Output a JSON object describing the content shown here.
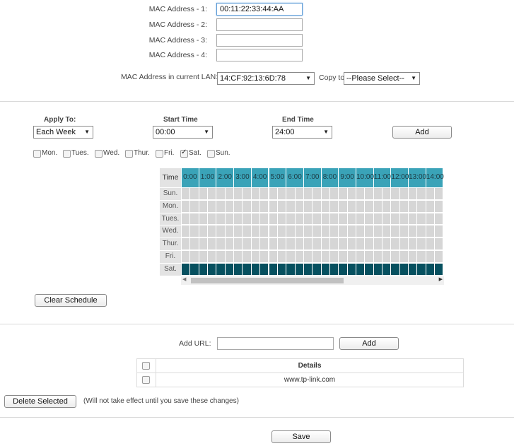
{
  "mac": {
    "labels": [
      "MAC Address - 1:",
      "MAC Address - 2:",
      "MAC Address - 3:",
      "MAC Address - 4:"
    ],
    "values": [
      "00:11:22:33:44:AA",
      "",
      "",
      ""
    ],
    "current_lan_label": "MAC Address in current LAN:",
    "current_lan_value": "14:CF:92:13:6D:78",
    "copy_to_label": "Copy to",
    "copy_to_value": "--Please Select--"
  },
  "schedule": {
    "apply_to_label": "Apply To:",
    "apply_to_value": "Each Week",
    "start_time_label": "Start Time",
    "start_time_value": "00:00",
    "end_time_label": "End Time",
    "end_time_value": "24:00",
    "add_label": "Add",
    "days": [
      {
        "label": "Mon.",
        "checked": false
      },
      {
        "label": "Tues.",
        "checked": false
      },
      {
        "label": "Wed.",
        "checked": false
      },
      {
        "label": "Thur.",
        "checked": false
      },
      {
        "label": "Fri.",
        "checked": false
      },
      {
        "label": "Sat.",
        "checked": true
      },
      {
        "label": "Sun.",
        "checked": false
      }
    ],
    "grid": {
      "corner_label": "Time",
      "hours": [
        "0:00",
        "1:00",
        "2:00",
        "3:00",
        "4:00",
        "5:00",
        "6:00",
        "7:00",
        "8:00",
        "9:00",
        "10:00",
        "11:00",
        "12:00",
        "13:00",
        "14:00"
      ],
      "rows": [
        "Sun.",
        "Mon.",
        "Tues.",
        "Wed.",
        "Thur.",
        "Fri.",
        "Sat."
      ],
      "active_rows": [
        "Sat."
      ],
      "header_color": "#3aa3b8",
      "active_color": "#06505f",
      "inactive_color": "#d6d6d6"
    },
    "clear_label": "Clear Schedule"
  },
  "url": {
    "add_url_label": "Add URL:",
    "add_url_value": "",
    "add_label": "Add",
    "details_header": "Details",
    "rows": [
      {
        "details": "www.tp-link.com"
      }
    ]
  },
  "actions": {
    "delete_label": "Delete Selected",
    "delete_note": "(Will not take effect until you save these changes)",
    "save_label": "Save"
  }
}
